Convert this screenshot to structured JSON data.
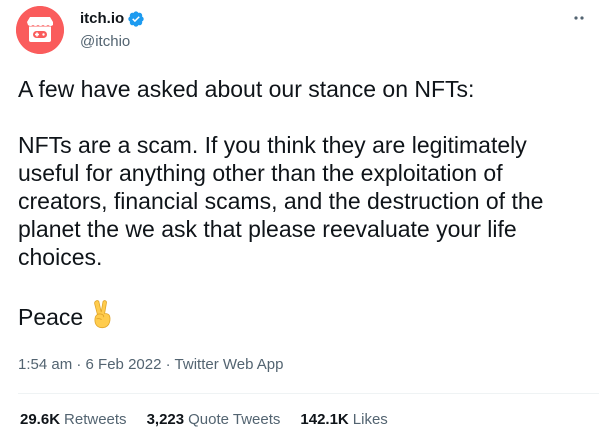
{
  "account": {
    "display_name": "itch.io",
    "handle": "@itchio",
    "verified": true,
    "avatar_icon": "itchio-logo-icon",
    "avatar_color": "#fa5c5c"
  },
  "tweet": {
    "paragraphs": [
      "A few have asked about our stance on NFTs:",
      "NFTs are a scam. If you think they are legitimately useful for anything other than the exploitation of creators, financial scams, and the destruction of the planet the we ask that please reevaluate your life choices.",
      "Peace"
    ],
    "emoji": "victory-hand-icon"
  },
  "meta": {
    "time": "1:54 am",
    "separator": "·",
    "date": "6 Feb 2022",
    "source": "Twitter Web App"
  },
  "stats": [
    {
      "count": "29.6K",
      "label": "Retweets"
    },
    {
      "count": "3,223",
      "label": "Quote Tweets"
    },
    {
      "count": "142.1K",
      "label": "Likes"
    }
  ],
  "colors": {
    "text_primary": "#0f1419",
    "text_secondary": "#536471",
    "verified_blue": "#1d9bf0",
    "divider": "#eff3f4"
  }
}
